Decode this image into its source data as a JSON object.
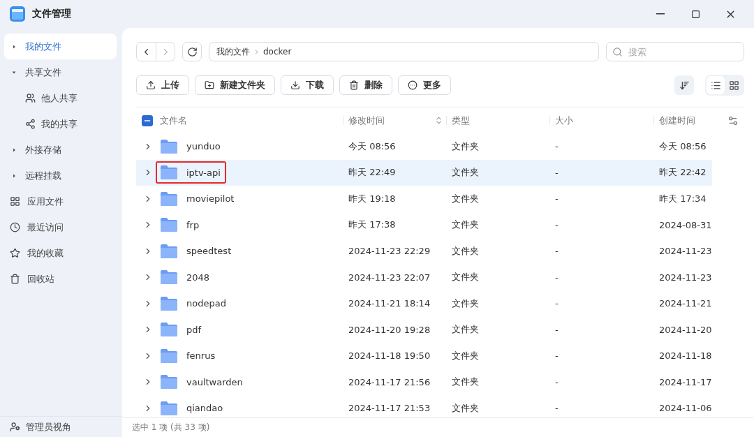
{
  "window": {
    "title": "文件管理"
  },
  "sidebar": {
    "items": [
      {
        "kind": "tree",
        "label": "我的文件",
        "selected": true,
        "expanded": false
      },
      {
        "kind": "tree",
        "label": "共享文件",
        "selected": false,
        "expanded": true,
        "children": [
          {
            "label": "他人共享",
            "selected": false
          },
          {
            "label": "我的共享",
            "selected": false
          }
        ]
      },
      {
        "kind": "tree",
        "label": "外接存储",
        "selected": false,
        "expanded": false
      },
      {
        "kind": "tree",
        "label": "远程挂载",
        "selected": false,
        "expanded": false
      },
      {
        "kind": "link",
        "label": "应用文件",
        "selected": false
      },
      {
        "kind": "link",
        "label": "最近访问",
        "selected": false
      },
      {
        "kind": "link",
        "label": "我的收藏",
        "selected": false
      },
      {
        "kind": "link",
        "label": "回收站",
        "selected": false
      }
    ],
    "footer": "管理员视角"
  },
  "path": [
    "我的文件",
    "docker"
  ],
  "search": {
    "placeholder": "搜索"
  },
  "actions": [
    "上传",
    "新建文件夹",
    "下载",
    "删除",
    "更多"
  ],
  "view": [
    {
      "kind": "list",
      "selected": true
    },
    {
      "kind": "grid",
      "selected": false
    }
  ],
  "table": {
    "select_all_partial": true,
    "columns": [
      {
        "label": "文件名"
      },
      {
        "label": "修改时间",
        "sorted": true
      },
      {
        "label": "类型"
      },
      {
        "label": "大小"
      },
      {
        "label": "创建时间"
      }
    ],
    "rows": [
      {
        "name": "yunduo",
        "modified": "今天 08:56",
        "type": "文件夹",
        "size": "-",
        "created": "今天 08:56",
        "selected": false,
        "annotated": false
      },
      {
        "name": "iptv-api",
        "modified": "昨天 22:49",
        "type": "文件夹",
        "size": "-",
        "created": "昨天 22:42",
        "selected": true,
        "annotated": true
      },
      {
        "name": "moviepilot",
        "modified": "昨天 19:18",
        "type": "文件夹",
        "size": "-",
        "created": "昨天 17:34",
        "selected": false,
        "annotated": false
      },
      {
        "name": "frp",
        "modified": "昨天 17:38",
        "type": "文件夹",
        "size": "-",
        "created": "2024-08-31",
        "selected": false,
        "annotated": false
      },
      {
        "name": "speedtest",
        "modified": "2024-11-23 22:29",
        "type": "文件夹",
        "size": "-",
        "created": "2024-11-23",
        "selected": false,
        "annotated": false
      },
      {
        "name": "2048",
        "modified": "2024-11-23 22:07",
        "type": "文件夹",
        "size": "-",
        "created": "2024-11-23",
        "selected": false,
        "annotated": false
      },
      {
        "name": "nodepad",
        "modified": "2024-11-21 18:14",
        "type": "文件夹",
        "size": "-",
        "created": "2024-11-21",
        "selected": false,
        "annotated": false
      },
      {
        "name": "pdf",
        "modified": "2024-11-20 19:28",
        "type": "文件夹",
        "size": "-",
        "created": "2024-11-20",
        "selected": false,
        "annotated": false
      },
      {
        "name": "fenrus",
        "modified": "2024-11-18 19:50",
        "type": "文件夹",
        "size": "-",
        "created": "2024-11-18",
        "selected": false,
        "annotated": false
      },
      {
        "name": "vaultwarden",
        "modified": "2024-11-17 21:56",
        "type": "文件夹",
        "size": "-",
        "created": "2024-11-17",
        "selected": false,
        "annotated": false
      },
      {
        "name": "qiandao",
        "modified": "2024-11-17 21:53",
        "type": "文件夹",
        "size": "-",
        "created": "2024-11-06",
        "selected": false,
        "annotated": false
      }
    ]
  },
  "status_bar": "选中 1 项 (共 33 项)"
}
